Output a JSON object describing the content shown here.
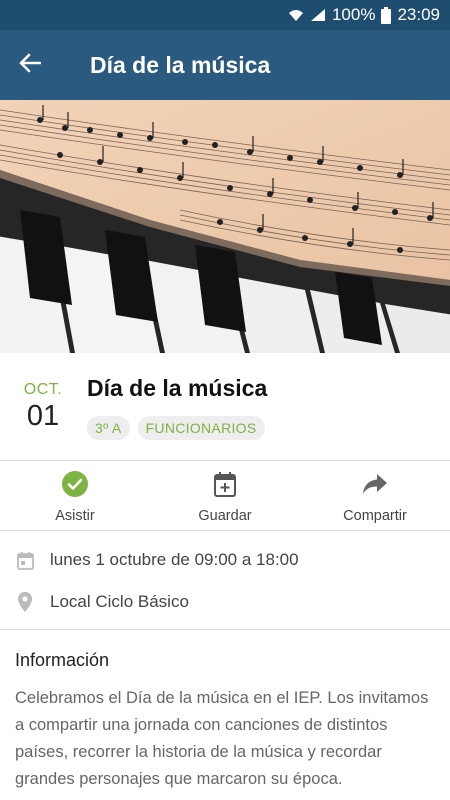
{
  "status_bar": {
    "battery": "100%",
    "time": "23:09"
  },
  "app_bar": {
    "title": "Día de la música",
    "back_icon": "arrow-back-icon"
  },
  "event": {
    "month": "OCT.",
    "day": "01",
    "title": "Día de la música",
    "tags": [
      "3º A",
      "FUNCIONARIOS"
    ]
  },
  "actions": [
    {
      "label": "Asistir",
      "icon": "check-circle-icon"
    },
    {
      "label": "Guardar",
      "icon": "calendar-add-icon"
    },
    {
      "label": "Compartir",
      "icon": "share-icon"
    }
  ],
  "details": {
    "datetime": "lunes 1 octubre de 09:00 a 18:00",
    "location": "Local Ciclo Básico"
  },
  "info": {
    "heading": "Información",
    "body": "Celebramos el Día de la música en el IEP. Los invitamos a compartir una jornada con canciones de distintos países, recorrer la historia de la música y recordar grandes personajes que marcaron su época."
  },
  "colors": {
    "status_bar": "#1f4d70",
    "app_bar": "#2a5a80",
    "accent_green": "#7cb342",
    "divider": "#dcdcdc"
  }
}
